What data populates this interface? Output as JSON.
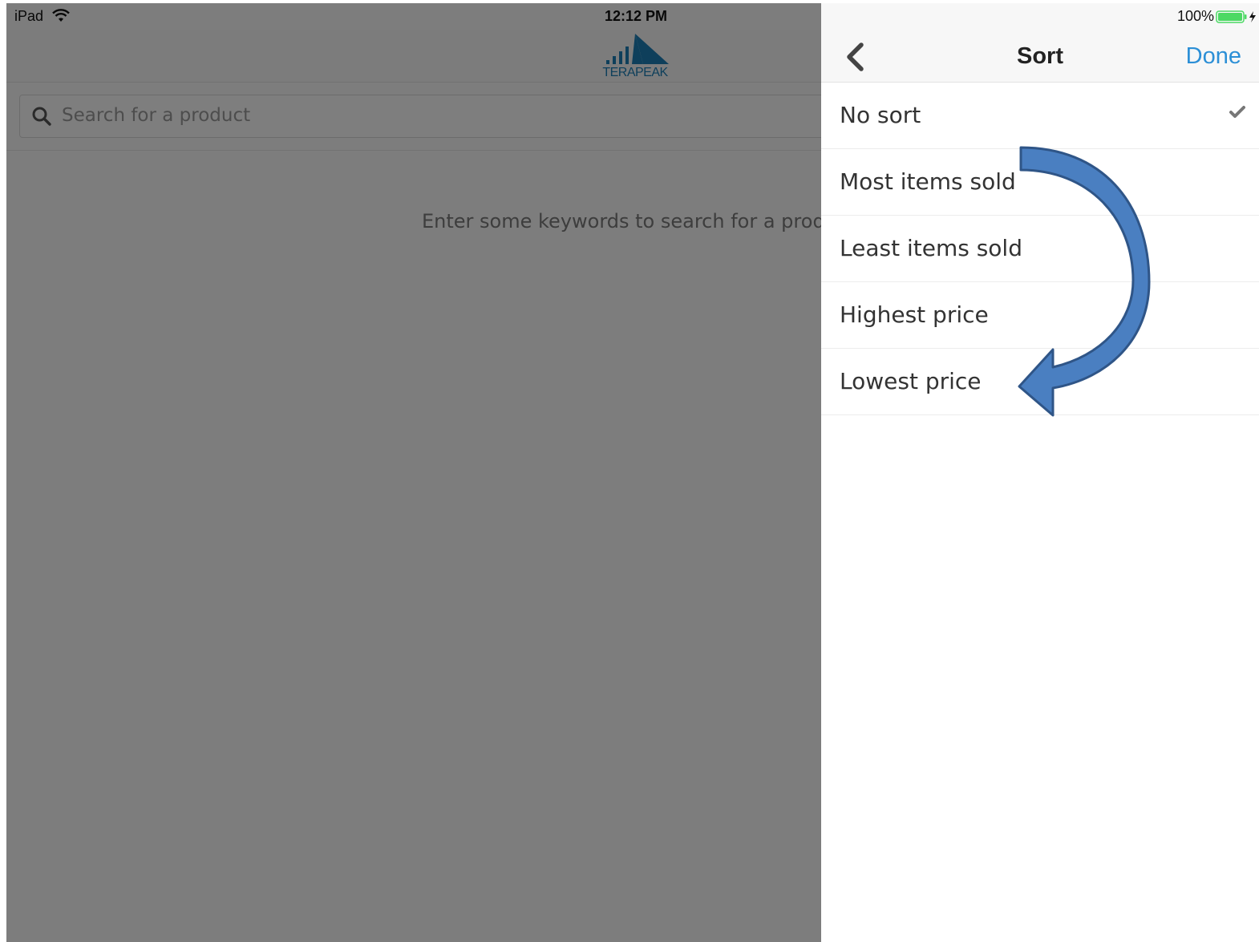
{
  "status_bar": {
    "device": "iPad",
    "time": "12:12 PM",
    "battery": "100%"
  },
  "app": {
    "logo_text": "TERAPEAK",
    "search": {
      "placeholder": "Search for a product",
      "value": ""
    },
    "empty_hint": "Enter some keywords to search for a product"
  },
  "sort_panel": {
    "title": "Sort",
    "back_icon": "chevron-left-icon",
    "done_label": "Done",
    "options": [
      {
        "label": "No sort",
        "selected": true
      },
      {
        "label": "Most items sold",
        "selected": false
      },
      {
        "label": "Least items sold",
        "selected": false
      },
      {
        "label": "Highest price",
        "selected": false
      },
      {
        "label": "Lowest price",
        "selected": false
      }
    ]
  },
  "colors": {
    "accent": "#2c8fd6",
    "logo_blue": "#1c7fb7",
    "arrow_fill": "#4a7fc1",
    "arrow_stroke": "#2f5587",
    "battery_green": "#4cd964"
  }
}
